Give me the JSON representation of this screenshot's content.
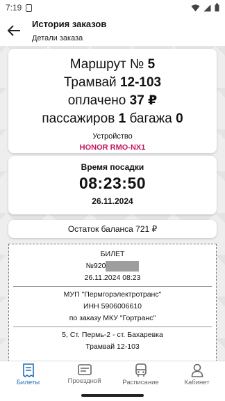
{
  "status_bar": {
    "time": "7:19"
  },
  "header": {
    "title": "История заказов",
    "subtitle": "Детали заказа"
  },
  "order": {
    "route_label": "Маршрут №",
    "route_number": "5",
    "vehicle_label": "Трамвай",
    "vehicle_number": "12-103",
    "paid_label": "оплачено",
    "paid_amount": "37 ₽",
    "passengers_label": "пассажиров",
    "passengers_count": "1",
    "baggage_label": "багажа",
    "baggage_count": "0",
    "device_label": "Устройство",
    "device_name": "HONOR RMO-NX1"
  },
  "boarding": {
    "label": "Время посадки",
    "time": "08:23:50",
    "date": "26.11.2024"
  },
  "balance": {
    "text": "Остаток баланса 721 ₽"
  },
  "ticket": {
    "title": "БИЛЕТ",
    "number_prefix": "№920",
    "datetime": "26.11.2024 08:23",
    "org": "МУП \"Пермгорэлектротранс\"",
    "inn": "ИНН 5906006610",
    "order_by": "по заказу МКУ \"Гортранс\"",
    "route_desc": "5, Ст. Пермь-2 - ст. Бахаревка",
    "vehicle": "Трамвай 12-103"
  },
  "nav": {
    "items": [
      {
        "label": "Билеты",
        "icon": "ticket-icon",
        "active": true
      },
      {
        "label": "Проездной",
        "icon": "card-icon",
        "active": false
      },
      {
        "label": "Расписание",
        "icon": "bus-icon",
        "active": false
      },
      {
        "label": "Кабинет",
        "icon": "user-icon",
        "active": false
      }
    ]
  },
  "colors": {
    "accent": "#1e6fb6",
    "device": "#c2185b"
  }
}
